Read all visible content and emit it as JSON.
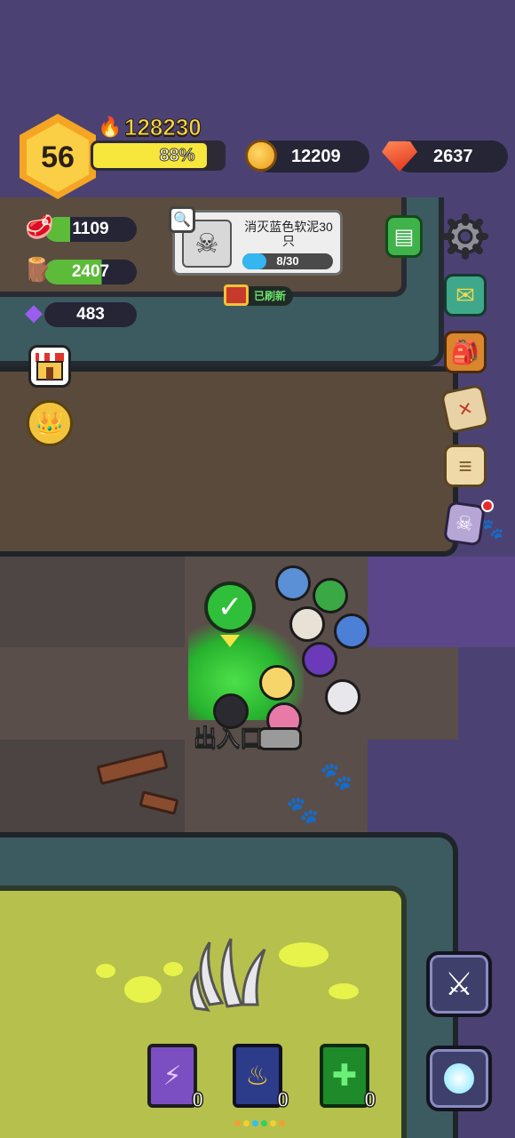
{
  "player": {
    "level": "56",
    "power": "128230",
    "xp_percent_label": "88%",
    "xp_fraction": 0.88
  },
  "currencies": {
    "coins": "12209",
    "gems": "2637"
  },
  "resources": {
    "meat": "1109",
    "wood": "2407",
    "crystal": "483"
  },
  "quest": {
    "title": "消灭蓝色软泥30只",
    "progress_label": "8/30",
    "progress_fraction": 0.2667,
    "refresh_label": "已刷新"
  },
  "map": {
    "entrance_label": "出入口"
  },
  "skill_books": [
    {
      "count": "0",
      "color": "#7b4fc2",
      "icon": "lightning-icon"
    },
    {
      "count": "0",
      "color": "#2d3c8a",
      "icon": "flame-icon"
    },
    {
      "count": "0",
      "color": "#1e8a2a",
      "icon": "cross-icon"
    }
  ],
  "colors": {
    "xp_bar": "#f7e63c",
    "quest_bar": "#34b6f0",
    "power_text": "#f7d64a"
  }
}
